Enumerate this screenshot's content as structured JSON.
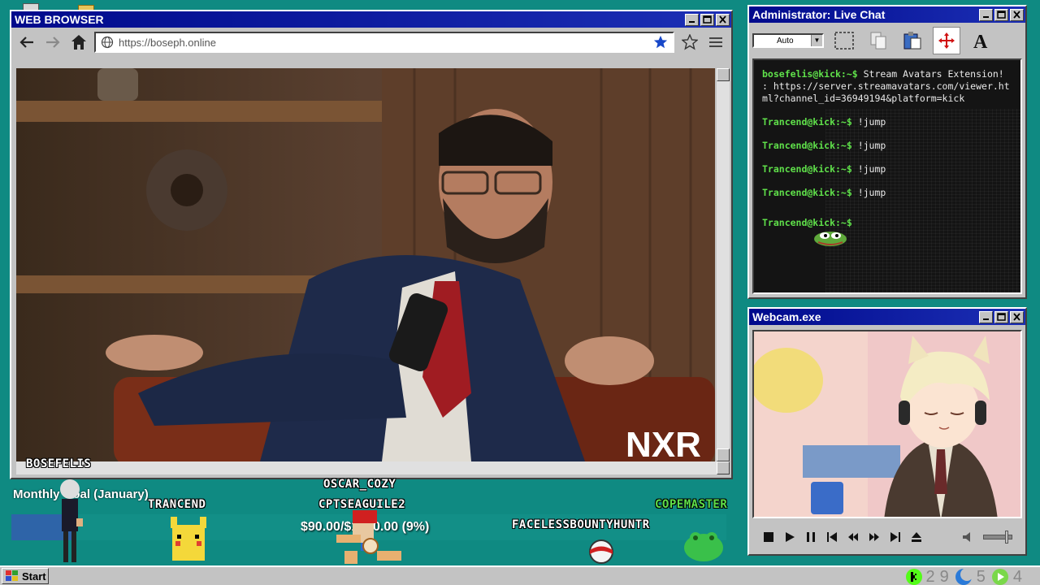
{
  "browser": {
    "title": "WEB BROWSER",
    "url": "https://boseph.online",
    "nav": {
      "back": "back",
      "forward": "forward",
      "home": "home"
    },
    "video_watermark": "NXR"
  },
  "chat": {
    "title": "Administrator: Live Chat",
    "combo_value": "Auto",
    "messages": [
      {
        "user": "bosefelis@kick:~$",
        "text": " Stream Avatars Extension! : https://server.streamavatars.com/viewer.html?channel_id=36949194&platform=kick"
      },
      {
        "user": "Trancend@kick:~$",
        "text": " !jump"
      },
      {
        "user": "Trancend@kick:~$",
        "text": " !jump"
      },
      {
        "user": "Trancend@kick:~$",
        "text": " !jump"
      },
      {
        "user": "Trancend@kick:~$",
        "text": " !jump"
      },
      {
        "user": "Trancend@kick:~$",
        "text": ""
      }
    ]
  },
  "webcam": {
    "title": "Webcam.exe"
  },
  "overlay": {
    "goal_label": "Monthly Goal (January)",
    "goal_text": "$90.00/$1000.00 (9%)",
    "goal_progress": 0.09,
    "avatars": [
      "BOSEFELIS",
      "TRANCEND",
      "OSCAR_COZY",
      "CPTSEAGUILE2",
      "FACELESSBOUNTYHUNTR",
      "COPEMASTER"
    ]
  },
  "taskbar": {
    "start_label": "Start",
    "tray": [
      "2",
      "9",
      "5",
      "4"
    ]
  },
  "colors": {
    "desktop": "#0f8a82",
    "titlebar": "#000a8c",
    "chat_user": "#5fe04a",
    "goal_fill": "#2e64a8"
  }
}
